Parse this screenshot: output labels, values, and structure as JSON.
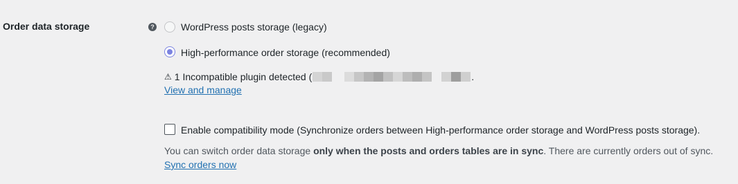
{
  "setting": {
    "label": "Order data storage",
    "help_icon": "question-circle-icon"
  },
  "options": [
    {
      "label": "WordPress posts storage (legacy)",
      "checked": false
    },
    {
      "label": "High-performance order storage (recommended)",
      "checked": true
    }
  ],
  "warning": {
    "icon": "warning-triangle-icon",
    "text": "1 Incompatible plugin detected (",
    "suffix": ".",
    "link": "View and manage"
  },
  "compat": {
    "label": "Enable compatibility mode (Synchronize orders between High-performance order storage and WordPress posts storage).",
    "checked": false
  },
  "sync": {
    "desc_pre": "You can switch order data storage ",
    "desc_bold": "only when the posts and orders tables are in sync",
    "desc_post": ". There are currently orders out of sync.",
    "link": "Sync orders now"
  },
  "colors": {
    "accent": "#7b83e0",
    "link": "#2271b1",
    "background": "#f0f0f1"
  }
}
